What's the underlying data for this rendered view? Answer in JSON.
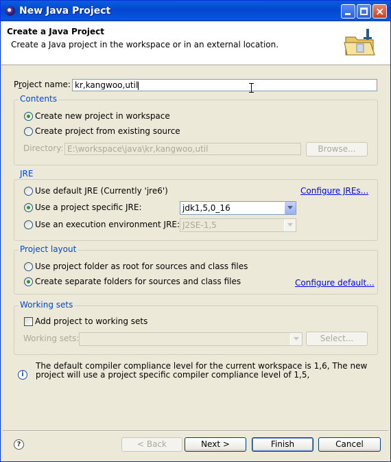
{
  "window": {
    "title": "New Java Project"
  },
  "header": {
    "title": "Create a Java Project",
    "subtitle": "Create a Java project in the workspace or in an external location."
  },
  "project_name": {
    "label_pre": "P",
    "label_u": "r",
    "label_post": "oject name:",
    "value": "kr,kangwoo,util"
  },
  "contents": {
    "title": "Contents",
    "option_new": "Create new project in workspace",
    "option_existing": "Create project from existing source",
    "directory_label": "Directory:",
    "directory_value": "E:\\workspace\\java\\kr,kangwoo,util",
    "browse_label": "Browse..."
  },
  "jre": {
    "title": "JRE",
    "option_default": "Use default JRE (Currently 'jre6')",
    "configure_link": "Configure JREs...",
    "option_specific": "Use a project specific JRE:",
    "specific_value": "jdk1,5,0_16",
    "option_env": "Use an execution environment JRE:",
    "env_value": "J2SE-1,5"
  },
  "layout": {
    "title": "Project layout",
    "option_root": "Use project folder as root for sources and class files",
    "option_separate": "Create separate folders for sources and class files",
    "configure_link": "Configure default..."
  },
  "working_sets": {
    "title": "Working sets",
    "add_label": "Add project to working sets",
    "sets_label": "Working sets:",
    "select_label": "Select..."
  },
  "info": {
    "line1": "The default compiler compliance level for the current workspace is 1,6, The new",
    "line2": "project will use a project specific compiler compliance level of 1,5,"
  },
  "buttons": {
    "back": "< Back",
    "next": "Next >",
    "finish": "Finish",
    "cancel": "Cancel"
  }
}
